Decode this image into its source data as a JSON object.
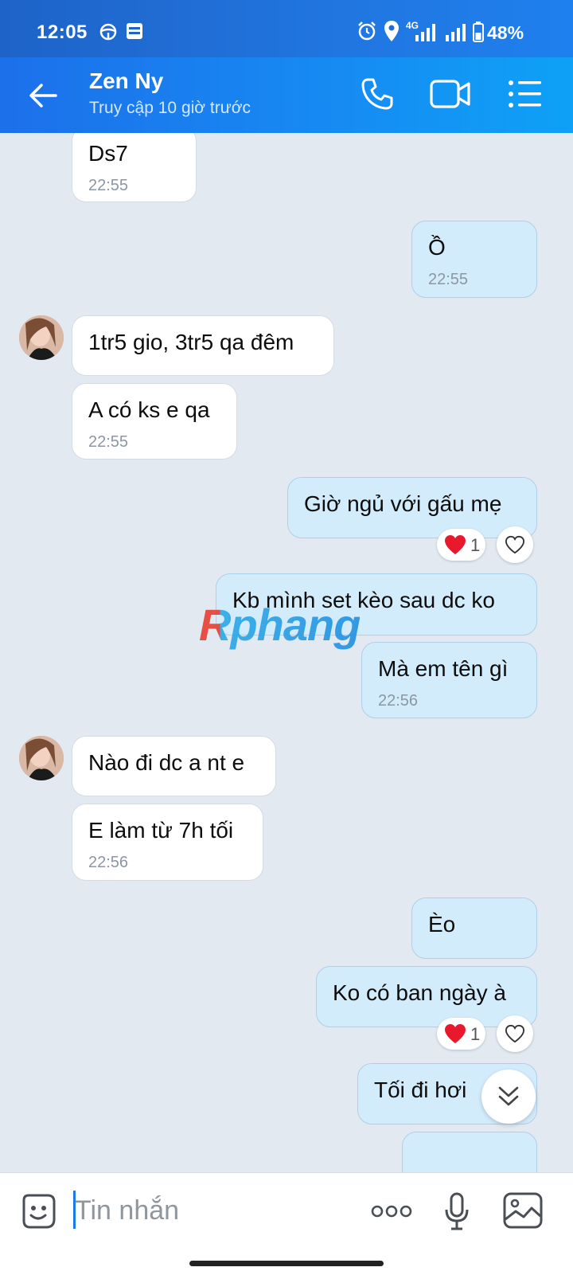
{
  "status_bar": {
    "time": "12:05",
    "battery": "48%",
    "network": "4G"
  },
  "header": {
    "contact_name": "Zen Ny",
    "status": "Truy cập 10 giờ trước"
  },
  "messages": [
    {
      "dir": "in",
      "text": "Ds7",
      "time": "22:55"
    },
    {
      "dir": "out",
      "text": "Ồ",
      "time": "22:55"
    },
    {
      "dir": "in",
      "text": "1tr5 gio, 3tr5 qa đêm"
    },
    {
      "dir": "in",
      "text": "A có ks e qa",
      "time": "22:55"
    },
    {
      "dir": "out",
      "text": "Giờ ngủ với gấu mẹ",
      "reaction_count": "1"
    },
    {
      "dir": "out",
      "text": "Kb mình set kèo sau dc ko"
    },
    {
      "dir": "out",
      "text": "Mà em tên gì",
      "time": "22:56"
    },
    {
      "dir": "in",
      "text": "Nào đi dc a nt e"
    },
    {
      "dir": "in",
      "text": "E làm từ 7h tối",
      "time": "22:56"
    },
    {
      "dir": "out",
      "text": "Èo"
    },
    {
      "dir": "out",
      "text": "Ko có ban ngày à",
      "reaction_count": "1"
    },
    {
      "dir": "out",
      "text": "Tối đi hơi"
    }
  ],
  "watermark": "Rphang",
  "input": {
    "placeholder": "Tin nhắn"
  },
  "colors": {
    "header_accent": "#1789f2",
    "outgoing_bubble": "#d3ecfb",
    "incoming_bubble": "#ffffff",
    "background": "#e2e9f1",
    "reaction_heart": "#e8192c"
  }
}
